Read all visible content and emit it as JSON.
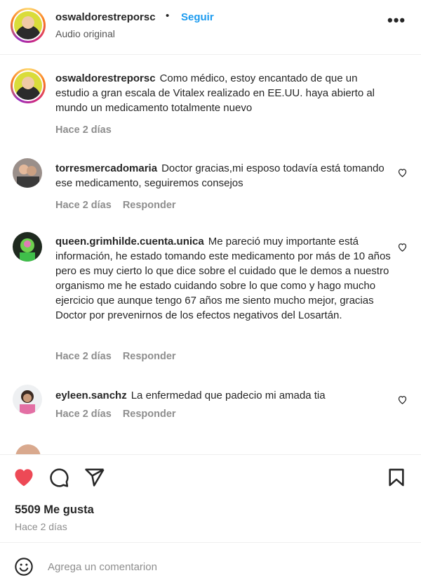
{
  "header": {
    "username": "oswaldorestreporsc",
    "separator": "•",
    "follow_label": "Seguir",
    "audio": "Audio original",
    "more": "•••"
  },
  "caption": {
    "username": "oswaldorestreporsc",
    "text": "Como médico, estoy encantado de que un estudio a gran escala de Vitalex realizado en EE.UU. haya abierto al mundo un medicamento totalmente nuevo",
    "time": "Hace 2 días"
  },
  "comments": [
    {
      "username": "torresmercadomaria",
      "text": "Doctor gracias,mi esposo todavía está tomando ese medicamento, seguiremos consejos",
      "time": "Hace 2 días",
      "reply": "Responder"
    },
    {
      "username": "queen.grimhilde.cuenta.unica",
      "text": "Me pareció muy importante está información, he estado tomando este medicamento por más de 10 años pero es muy cierto lo que dice sobre el cuidado que le demos a nuestro organismo me he estado cuidando sobre lo que como y hago mucho ejercicio que aunque tengo 67 años me siento mucho mejor, gracias Doctor por prevenirnos de los efectos negativos del Losartán.",
      "time": "Hace 2 días",
      "reply": "Responder"
    },
    {
      "username": "eyleen.sanchz",
      "text": "La enfermedad que padecio mi amada tia",
      "time": "Hace 2 días",
      "reply": "Responder"
    }
  ],
  "actions": {
    "likes": "5509 Me gusta",
    "posted": "Hace 2 días"
  },
  "composer": {
    "placeholder": "Agrega un comentarion"
  },
  "colors": {
    "like_red": "#ed4956",
    "follow_blue": "#1c9bef"
  }
}
